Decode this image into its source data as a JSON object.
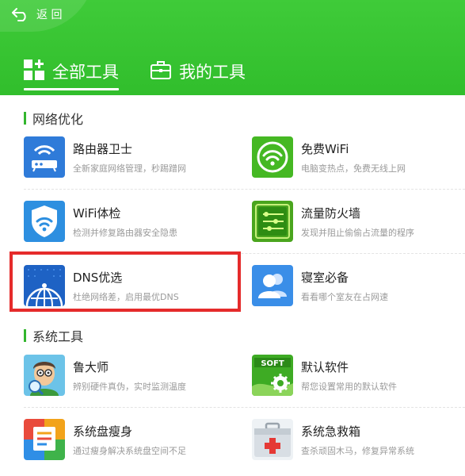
{
  "header": {
    "back_label": "返 回",
    "tabs": [
      {
        "label": "全部工具",
        "icon": "grid-plus-icon",
        "active": true
      },
      {
        "label": "我的工具",
        "icon": "toolbox-icon",
        "active": false
      }
    ]
  },
  "sections": [
    {
      "title": "网络优化",
      "items": [
        {
          "name": "路由器卫士",
          "desc": "全新家庭网络管理，秒踢蹭网",
          "icon": "router-icon"
        },
        {
          "name": "免费WiFi",
          "desc": "电脑变热点，免费无线上网",
          "icon": "wifi-icon"
        },
        {
          "name": "WiFi体检",
          "desc": "检测并修复路由器安全隐患",
          "icon": "wifi-shield-icon"
        },
        {
          "name": "流量防火墙",
          "desc": "发现并阻止偷偷占流量的程序",
          "icon": "traffic-firewall-icon"
        },
        {
          "name": "DNS优选",
          "desc": "杜绝网络差，启用最优DNS",
          "icon": "dns-globe-icon"
        },
        {
          "name": "寝室必备",
          "desc": "看看哪个室友在占网速",
          "icon": "roommates-icon"
        }
      ]
    },
    {
      "title": "系统工具",
      "items": [
        {
          "name": "鲁大师",
          "desc": "辨别硬件真伪，实时监测温度",
          "icon": "ludashi-icon"
        },
        {
          "name": "默认软件",
          "desc": "帮您设置常用的默认软件",
          "icon": "soft-gear-icon"
        },
        {
          "name": "系统盘瘦身",
          "desc": "通过瘦身解决系统盘空间不足",
          "icon": "disk-slim-icon"
        },
        {
          "name": "系统急救箱",
          "desc": "查杀顽固木马，修复异常系统",
          "icon": "first-aid-icon"
        }
      ]
    }
  ],
  "colors": {
    "header_green": "#3fcb39",
    "accent_green": "#33b62e",
    "highlight_red": "#e52b2b"
  },
  "soft_badge": "SOFT"
}
